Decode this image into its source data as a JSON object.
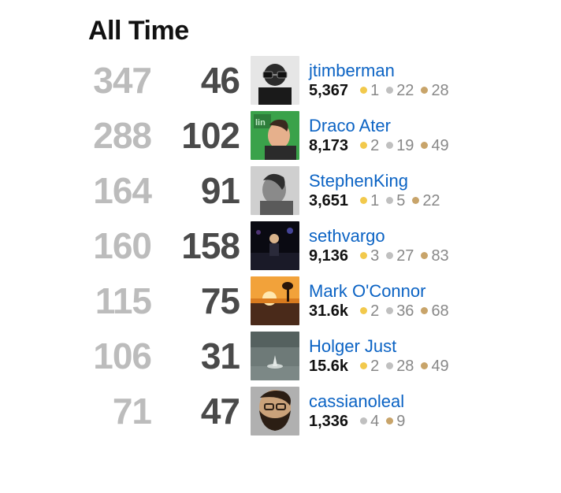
{
  "title": "All Time",
  "users": [
    {
      "scoreA": "347",
      "scoreB": "46",
      "name": "jtimberman",
      "rep": "5,367",
      "gold": "1",
      "silver": "22",
      "bronze": "28",
      "avatar": "bwface"
    },
    {
      "scoreA": "288",
      "scoreB": "102",
      "name": "Draco Ater",
      "rep": "8,173",
      "gold": "2",
      "silver": "19",
      "bronze": "49",
      "avatar": "greenprofile"
    },
    {
      "scoreA": "164",
      "scoreB": "91",
      "name": "StephenKing",
      "rep": "3,651",
      "gold": "1",
      "silver": "5",
      "bronze": "22",
      "avatar": "grayprofile"
    },
    {
      "scoreA": "160",
      "scoreB": "158",
      "name": "sethvargo",
      "rep": "9,136",
      "gold": "3",
      "silver": "27",
      "bronze": "83",
      "avatar": "stage"
    },
    {
      "scoreA": "115",
      "scoreB": "75",
      "name": "Mark O'Connor",
      "rep": "31.6k",
      "gold": "2",
      "silver": "36",
      "bronze": "68",
      "avatar": "sunset"
    },
    {
      "scoreA": "106",
      "scoreB": "31",
      "name": "Holger Just",
      "rep": "15.6k",
      "gold": "2",
      "silver": "28",
      "bronze": "49",
      "avatar": "lake"
    },
    {
      "scoreA": "71",
      "scoreB": "47",
      "name": "cassianoleal",
      "rep": "1,336",
      "gold": null,
      "silver": "4",
      "bronze": "9",
      "avatar": "beard"
    }
  ]
}
